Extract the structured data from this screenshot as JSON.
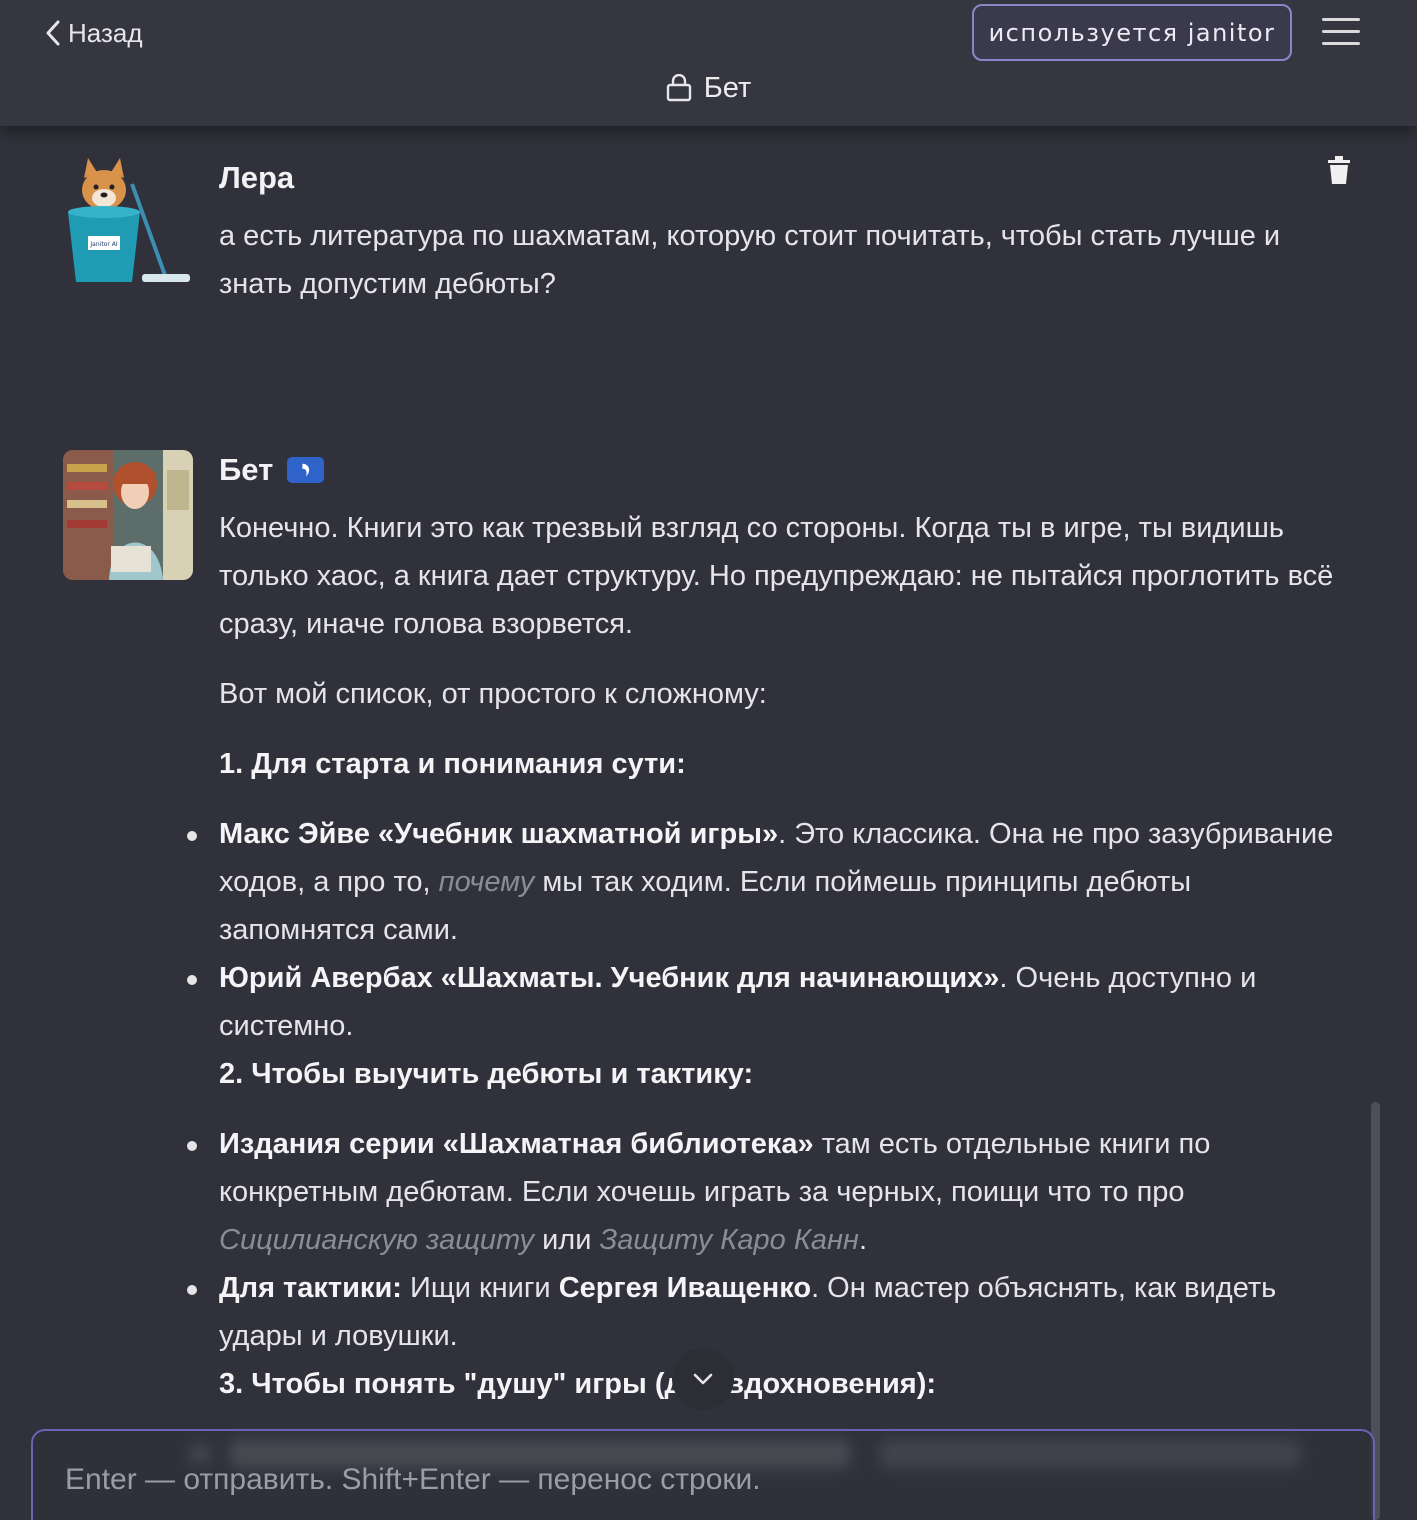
{
  "header": {
    "back_label": "Назад",
    "janitor_label": "используется janitor",
    "title": "Бет"
  },
  "messages": [
    {
      "author": "Лера",
      "avatar": "doge-in-bucket-mascot",
      "text": "а есть литература по шахматам, которую стоит почитать, чтобы стать лучше и знать допустим дебюты?"
    },
    {
      "author": "Бет",
      "avatar": "character-portrait",
      "badge_icon": "bot-badge-icon",
      "intro": "Конечно. Книги это как трезвый взгляд со стороны. Когда ты в игре, ты видишь только хаос, а книга дает структуру. Но предупреждаю: не пытайся проглотить всё сразу, иначе голова взорвется.",
      "list_intro": "Вот мой список, от простого к сложному:",
      "section1": "1. Для старта и понимания сути:",
      "s1_item1_bold": "Макс Эйве «Учебник шахматной игры»",
      "s1_item1_a": ". Это классика. Она не про зазубривание ходов, а про то, ",
      "s1_item1_em": "почему",
      "s1_item1_b": " мы так ходим. Если поймешь принципы дебюты запомнятся сами.",
      "s1_item2_bold": "Юрий Авербах «Шахматы. Учебник для начинающих»",
      "s1_item2_a": ". Очень доступно и системно.",
      "section2": "2. Чтобы выучить дебюты и тактику:",
      "s2_item1_bold": "Издания серии «Шахматная библиотека»",
      "s2_item1_a": " там есть отдельные книги по конкретным дебютам. Если хочешь играть за черных, поищи что то про ",
      "s2_item1_em1": "Сицилианскую защиту",
      "s2_item1_mid": " или ",
      "s2_item1_em2": "Защиту Каро Канн",
      "s2_item1_end": ".",
      "s2_item2_bold1": "Для тактики:",
      "s2_item2_a": " Ищи книги ",
      "s2_item2_bold2": "Сергея Иващенко",
      "s2_item2_b": ". Он мастер объяснять, как видеть удары и ловушки.",
      "section3": "3. Чтобы понять \"душу\" игры (для вдохновения):"
    }
  ],
  "composer": {
    "placeholder": "Enter — отправить. Shift+Enter — перенос строки."
  },
  "colors": {
    "background": "#30313a",
    "accent": "#8d84c9",
    "badge": "#2f63c9"
  }
}
